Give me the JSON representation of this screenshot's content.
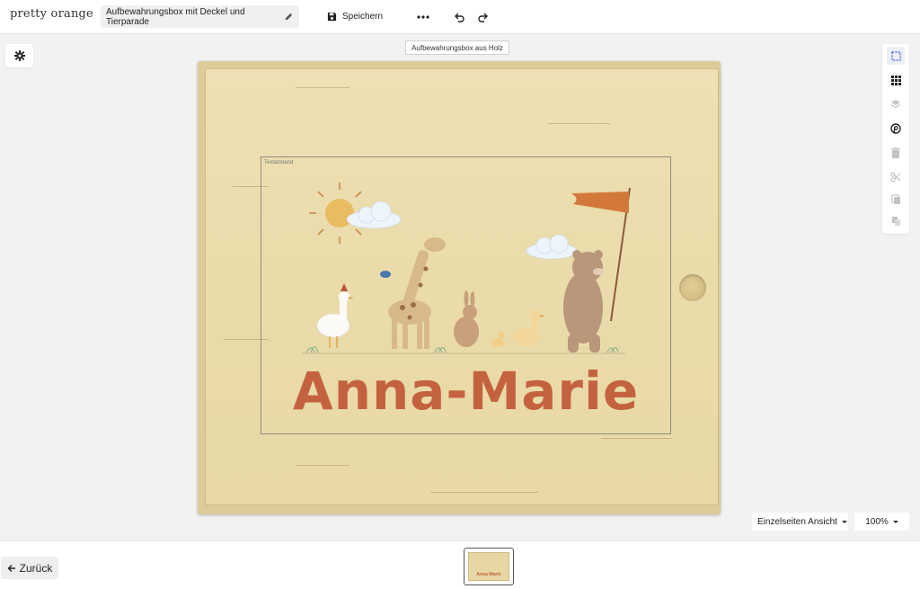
{
  "header": {
    "logo": "pretty orange",
    "document_title": "Aufbewahrungsbox mit Deckel und Tierparade",
    "save_label": "Speichern",
    "more_icon": "more-horizontal-icon",
    "undo_icon": "undo-icon",
    "redo_icon": "redo-icon"
  },
  "canvas": {
    "product_label": "Aufbewahrungsbox aus Holz",
    "text_area_label": "Textabstand",
    "name_text": "Anna-Marie",
    "name_color": "#c4623f",
    "wood_color": "#e8d9a6"
  },
  "toolbar_right": {
    "tools": [
      "select-icon",
      "grid-icon",
      "layers-icon",
      "pinterest-icon",
      "trash-icon",
      "scissors-icon",
      "copy-icon",
      "duplicate-icon"
    ]
  },
  "view": {
    "mode_label": "Einzelseiten Ansicht",
    "zoom_label": "100%"
  },
  "footer": {
    "back_label": "Zurück",
    "thumbnail_text": "Anna-Marie"
  }
}
